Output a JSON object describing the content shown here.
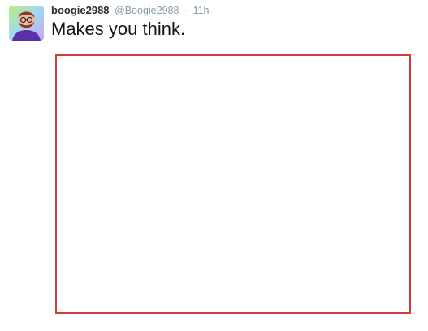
{
  "tweet": {
    "display_name": "boogie2988",
    "handle": "@Boogie2988",
    "separator": "·",
    "time": "11h",
    "text": "Makes you think."
  },
  "avatar": {
    "icon": "user-avatar-icon"
  },
  "media": {
    "border_color": "#d63a3a"
  }
}
